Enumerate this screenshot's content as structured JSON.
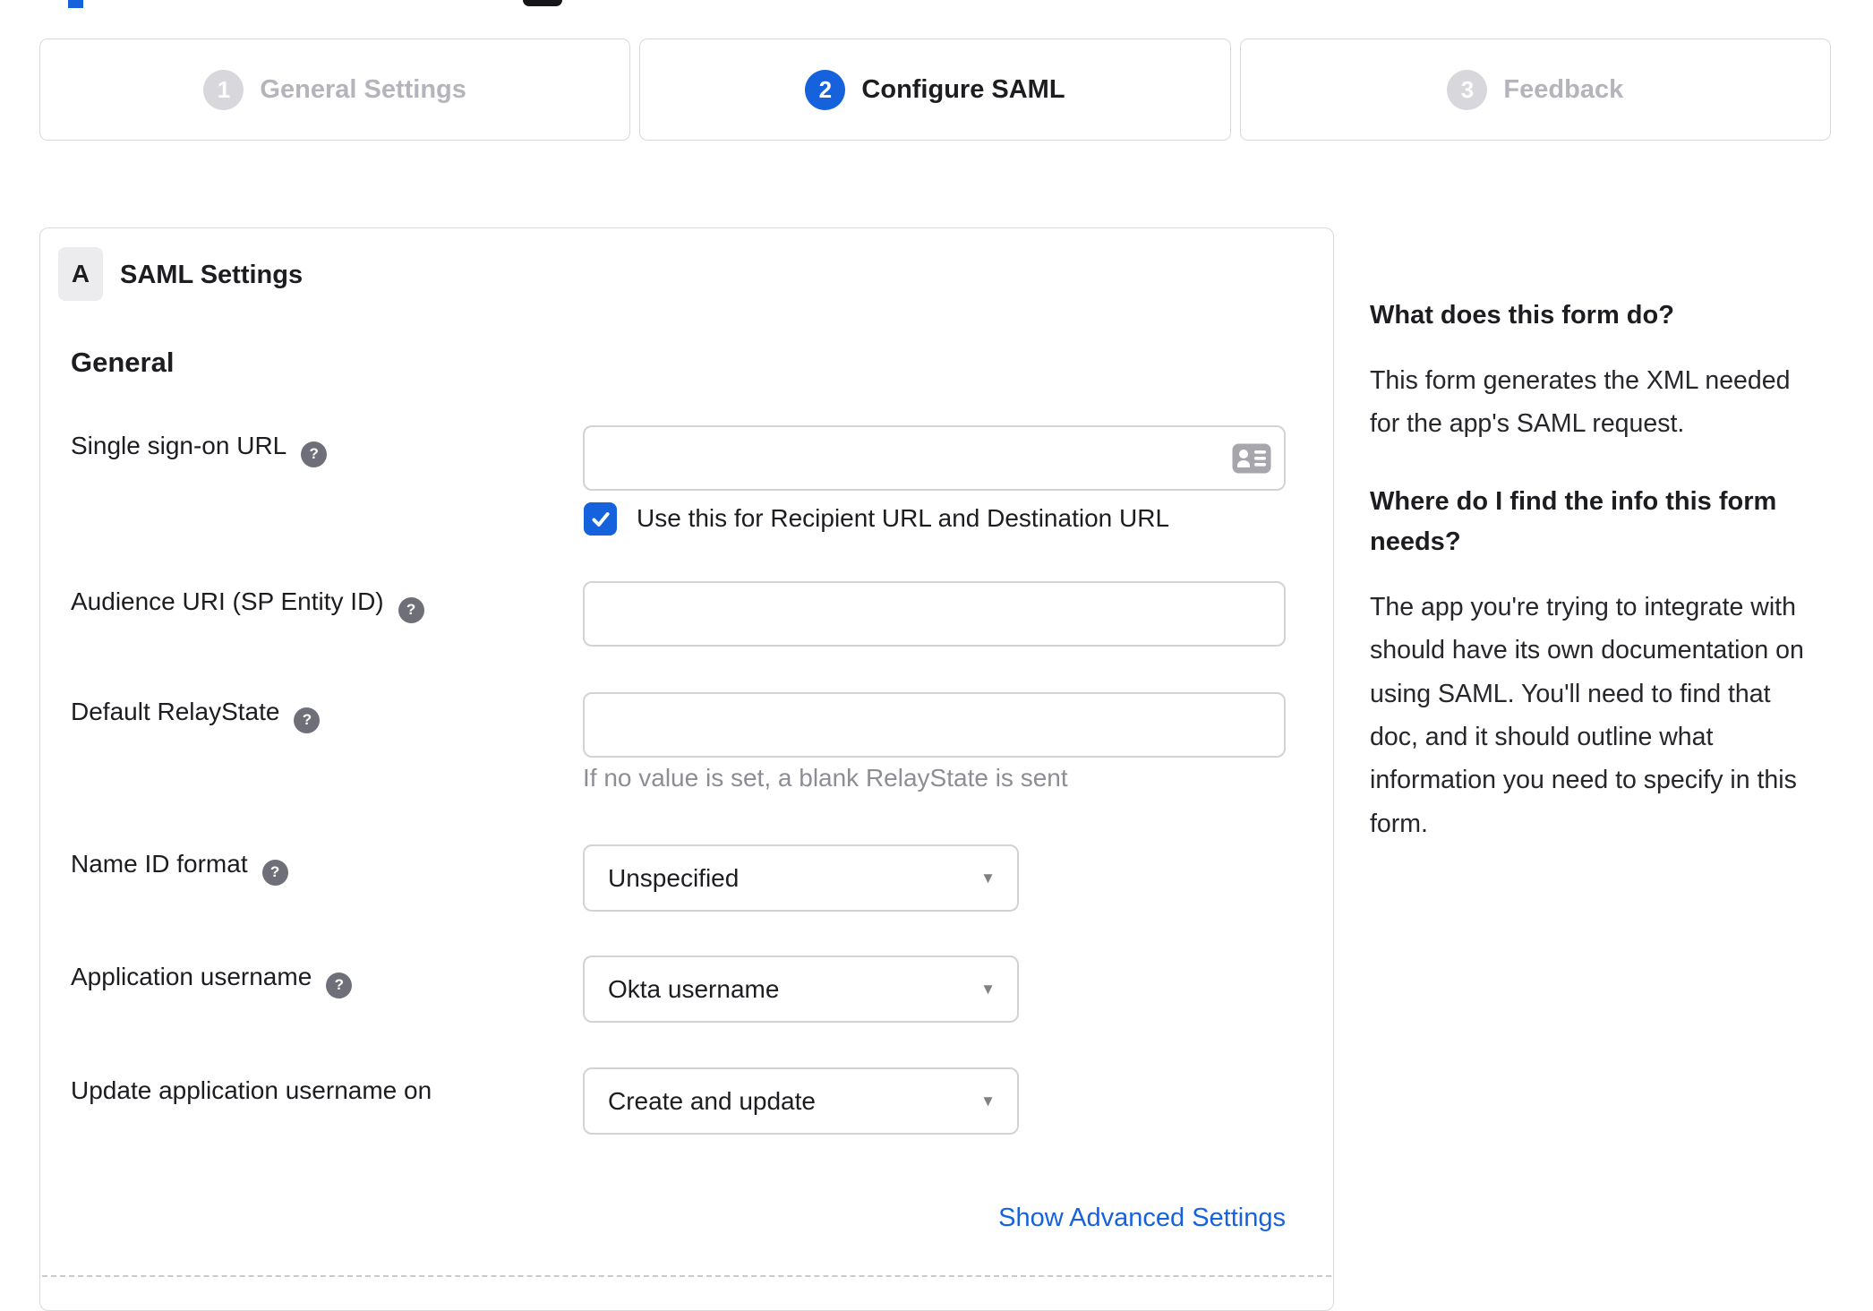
{
  "theme": {
    "accent_blue": "#1662dd",
    "container_border": "#d9d9de",
    "input_border": "#d2d2d7",
    "text_dark": "#1d1d21",
    "inactive_step_gray": "#d8d8dc",
    "inactive_label_gray": "#b4b4bc",
    "hint_gray": "#8d8d95",
    "help_icon_gray": "#6f6f79",
    "badge_bg": "#ececee"
  },
  "icons": {
    "help_icon": "?",
    "dropdown_arrow": "▼",
    "checkbox_check": "check-mark",
    "contact_card_icon": "contact-card"
  },
  "stepper": {
    "steps": [
      {
        "number": "1",
        "label": "General Settings",
        "state": "inactive"
      },
      {
        "number": "2",
        "label": "Configure SAML",
        "state": "active"
      },
      {
        "number": "3",
        "label": "Feedback",
        "state": "inactive"
      }
    ]
  },
  "panel": {
    "section_badge": "A",
    "section_title": "SAML Settings",
    "group_title": "General",
    "fields": {
      "sso": {
        "label": "Single sign-on URL",
        "value": "",
        "checkbox_label": "Use this for Recipient URL and Destination URL",
        "checked": true
      },
      "audience": {
        "label": "Audience URI (SP Entity ID)",
        "value": ""
      },
      "relay": {
        "label": "Default RelayState",
        "value": "",
        "hint": "If no value is set, a blank RelayState is sent"
      },
      "nameid": {
        "label": "Name ID format",
        "value": "Unspecified"
      },
      "appuser": {
        "label": "Application username",
        "value": "Okta username"
      },
      "updateuser": {
        "label": "Update application username on",
        "value": "Create and update"
      }
    },
    "advanced_link": "Show Advanced Settings"
  },
  "sidebar": {
    "blocks": [
      {
        "heading": "What does this form do?",
        "body": "This form generates the XML needed for the app's SAML request."
      },
      {
        "heading": "Where do I find the info this form needs?",
        "body": "The app you're trying to integrate with should have its own documentation on using SAML. You'll need to find that doc, and it should outline what information you need to specify in this form."
      }
    ]
  }
}
